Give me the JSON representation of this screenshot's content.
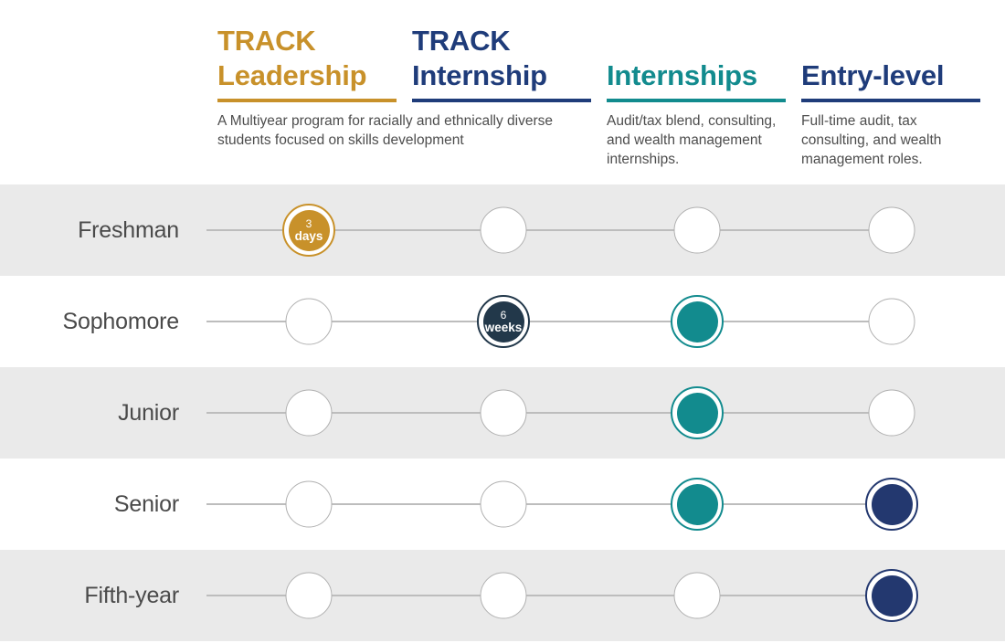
{
  "colors": {
    "gold": "#C8912A",
    "navy": "#1F3C7A",
    "teal": "#128B8E",
    "node_navy": "#23386F",
    "node_slate": "#22384A",
    "row_shaded": "#eaeaea",
    "line": "#bdbdbd"
  },
  "columns": [
    {
      "title": "TRACK\nLeadership",
      "accent": "gold",
      "description": "A Multiyear program for racially and ethnically diverse students focused on skills development"
    },
    {
      "title": "TRACK\nInternship",
      "accent": "navy",
      "description": ""
    },
    {
      "title": "Internships",
      "accent": "teal",
      "description": "Audit/tax blend, consulting, and wealth management internships."
    },
    {
      "title": "Entry-level",
      "accent": "navy",
      "description": "Full-time audit, tax consulting, and wealth management roles."
    }
  ],
  "rows": [
    {
      "label": "Freshman",
      "nodes": [
        {
          "state": "filled",
          "color": "gold",
          "number": "3",
          "unit": "days"
        },
        {
          "state": "empty",
          "color": "",
          "number": "",
          "unit": ""
        },
        {
          "state": "empty",
          "color": "",
          "number": "",
          "unit": ""
        },
        {
          "state": "empty",
          "color": "",
          "number": "",
          "unit": ""
        }
      ]
    },
    {
      "label": "Sophomore",
      "nodes": [
        {
          "state": "empty",
          "color": "",
          "number": "",
          "unit": ""
        },
        {
          "state": "filled",
          "color": "slate",
          "number": "6",
          "unit": "weeks"
        },
        {
          "state": "filled",
          "color": "teal",
          "number": "",
          "unit": ""
        },
        {
          "state": "empty",
          "color": "",
          "number": "",
          "unit": ""
        }
      ]
    },
    {
      "label": "Junior",
      "nodes": [
        {
          "state": "empty",
          "color": "",
          "number": "",
          "unit": ""
        },
        {
          "state": "empty",
          "color": "",
          "number": "",
          "unit": ""
        },
        {
          "state": "filled",
          "color": "teal",
          "number": "",
          "unit": ""
        },
        {
          "state": "empty",
          "color": "",
          "number": "",
          "unit": ""
        }
      ]
    },
    {
      "label": "Senior",
      "nodes": [
        {
          "state": "empty",
          "color": "",
          "number": "",
          "unit": ""
        },
        {
          "state": "empty",
          "color": "",
          "number": "",
          "unit": ""
        },
        {
          "state": "filled",
          "color": "teal",
          "number": "",
          "unit": ""
        },
        {
          "state": "filled",
          "color": "navy",
          "number": "",
          "unit": ""
        }
      ]
    },
    {
      "label": "Fifth-year",
      "nodes": [
        {
          "state": "empty",
          "color": "",
          "number": "",
          "unit": ""
        },
        {
          "state": "empty",
          "color": "",
          "number": "",
          "unit": ""
        },
        {
          "state": "empty",
          "color": "",
          "number": "",
          "unit": ""
        },
        {
          "state": "filled",
          "color": "navy",
          "number": "",
          "unit": ""
        }
      ]
    }
  ]
}
